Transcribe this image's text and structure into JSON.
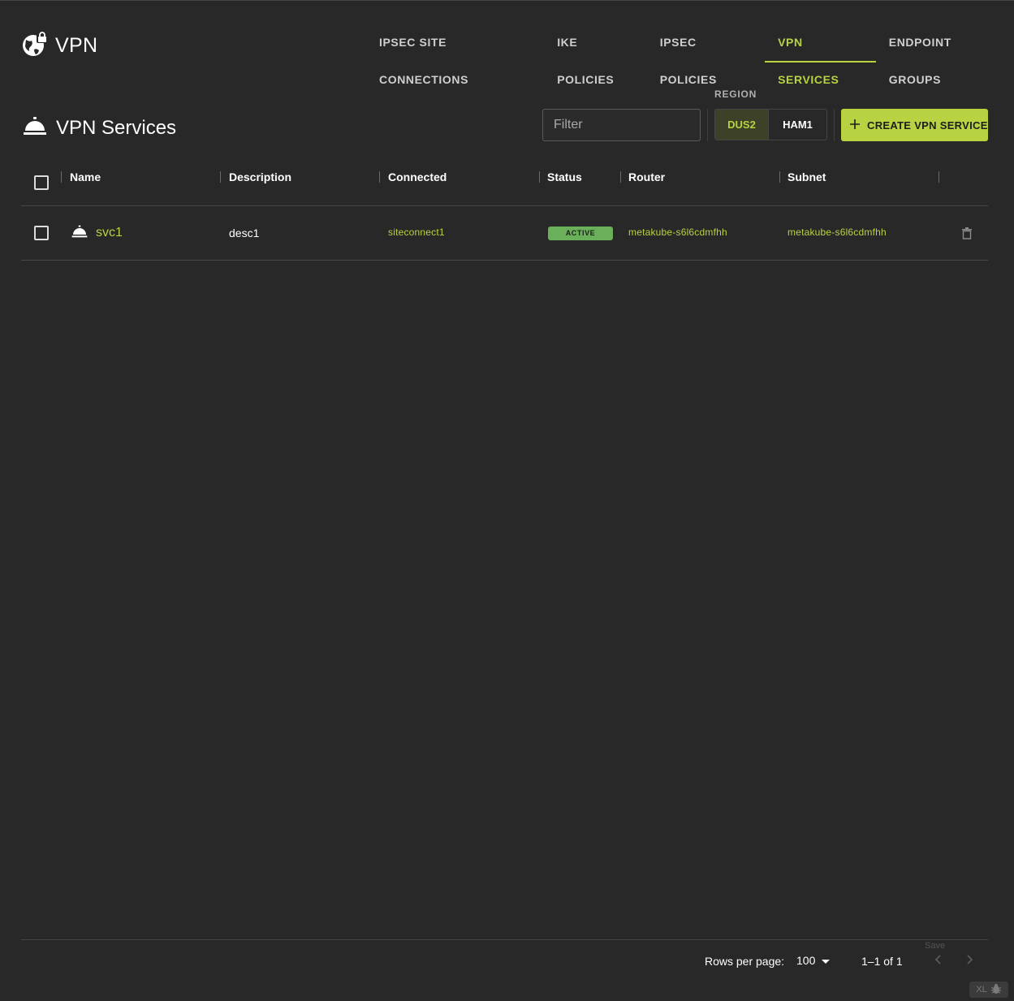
{
  "app": {
    "title": "VPN"
  },
  "nav": {
    "tabs": [
      {
        "label": "IPSEC SITE CONNECTIONS"
      },
      {
        "label": "IKE POLICIES"
      },
      {
        "label": "IPSEC POLICIES"
      },
      {
        "label": "VPN SERVICES",
        "active": true
      },
      {
        "label": "ENDPOINT GROUPS"
      }
    ]
  },
  "page": {
    "title": "VPN Services"
  },
  "filter": {
    "placeholder": "Filter",
    "value": ""
  },
  "region": {
    "label": "REGION",
    "options": [
      "DUS2",
      "HAM1"
    ],
    "selected": "DUS2"
  },
  "create_button": {
    "label": "CREATE VPN SERVICE"
  },
  "table": {
    "columns": [
      "Name",
      "Description",
      "Connected",
      "Status",
      "Router",
      "Subnet"
    ],
    "rows": [
      {
        "name": "svc1",
        "description": "desc1",
        "connected": "siteconnect1",
        "status": "ACTIVE",
        "router": "metakube-s6l6cdmfhh",
        "subnet": "metakube-s6l6cdmfhh"
      }
    ]
  },
  "pagination": {
    "rows_per_page_label": "Rows per page:",
    "rows_per_page": "100",
    "range": "1–1 of 1",
    "save_hint": "Save"
  },
  "badge": {
    "label": "XL"
  },
  "colors": {
    "accent": "#b7d341",
    "background": "#282828",
    "status_active": "#6ab05a"
  }
}
